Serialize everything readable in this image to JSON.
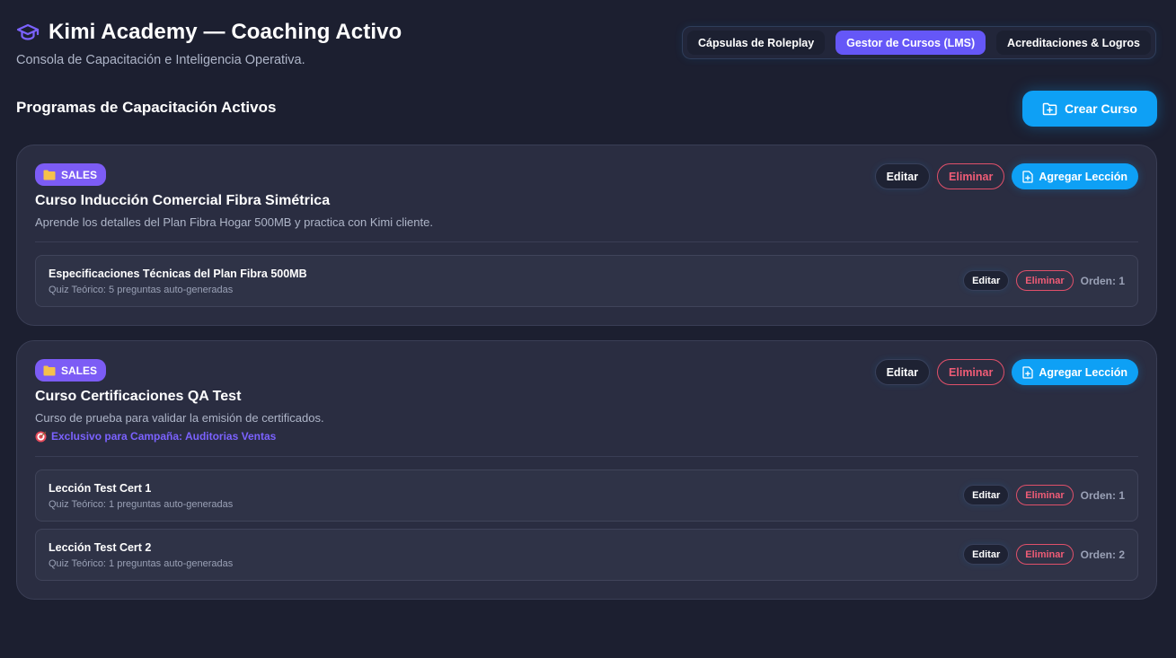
{
  "header": {
    "title": "Kimi Academy — Coaching Activo",
    "subtitle": "Consola de Capacitación e Inteligencia Operativa.",
    "icon": "graduation-cap-icon"
  },
  "tabs": [
    {
      "label": "Cápsulas de Roleplay",
      "active": false
    },
    {
      "label": "Gestor de Cursos (LMS)",
      "active": true
    },
    {
      "label": "Acreditaciones & Logros",
      "active": false
    }
  ],
  "section": {
    "title": "Programas de Capacitación Activos",
    "create_label": "Crear Curso"
  },
  "colors": {
    "background": "#1c1f30",
    "card": "#2a2d41",
    "accent_blue": "#0ea0f5",
    "accent_purple": "#6557f7",
    "badge": "#7c5cf5",
    "danger": "#ef5c76"
  },
  "courses": [
    {
      "badge": "SALES",
      "title": "Curso Inducción Comercial Fibra Simétrica",
      "description": "Aprende los detalles del Plan Fibra Hogar 500MB y practica con Kimi cliente.",
      "edit_label": "Editar",
      "delete_label": "Eliminar",
      "add_label": "Agregar Lección",
      "lessons": [
        {
          "title": "Especificaciones Técnicas del Plan Fibra 500MB",
          "subtitle": "Quiz Teórico: 5 preguntas auto-generadas",
          "edit_label": "Editar",
          "delete_label": "Eliminar",
          "order": "Orden: 1"
        }
      ]
    },
    {
      "badge": "SALES",
      "title": "Curso Certificaciones QA Test",
      "description": "Curso de prueba para validar la emisión de certificados.",
      "campaign": "Exclusivo para Campaña: Auditorias Ventas",
      "edit_label": "Editar",
      "delete_label": "Eliminar",
      "add_label": "Agregar Lección",
      "lessons": [
        {
          "title": "Lección Test Cert 1",
          "subtitle": "Quiz Teórico: 1 preguntas auto-generadas",
          "edit_label": "Editar",
          "delete_label": "Eliminar",
          "order": "Orden: 1"
        },
        {
          "title": "Lección Test Cert 2",
          "subtitle": "Quiz Teórico: 1 preguntas auto-generadas",
          "edit_label": "Editar",
          "delete_label": "Eliminar",
          "order": "Orden: 2"
        }
      ]
    }
  ]
}
